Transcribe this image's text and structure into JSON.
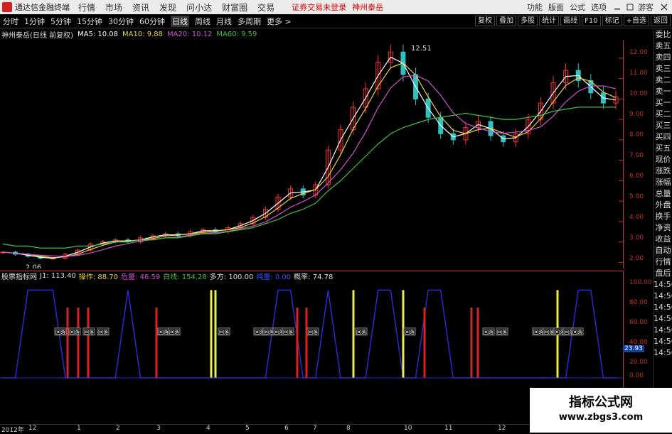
{
  "titlebar": {
    "app_name": "通达信金融终端",
    "menus": [
      "行情",
      "市场",
      "资讯",
      "发现",
      "问小达",
      "财富圈",
      "交易"
    ],
    "notice": "证券交易未登录",
    "stock_name": "神州泰岳",
    "right_items": [
      "功能",
      "版面",
      "公式",
      "选项",
      "游客"
    ]
  },
  "periods": [
    "分时",
    "1分钟",
    "5分钟",
    "15分钟",
    "30分钟",
    "60分钟",
    "日线",
    "周线",
    "月线",
    "多周期",
    "更多 >"
  ],
  "active_period": "日线",
  "tools": [
    "复权",
    "叠加",
    "多股",
    "统计",
    "画线",
    "F10",
    "标记",
    "+自选",
    "返回"
  ],
  "info": {
    "label": "神州泰岳(日线 前复权)",
    "ma5": "MA5: 10.08",
    "ma10": "MA10: 9.88",
    "ma20": "MA20: 10.12",
    "ma60": "MA60: 9.59"
  },
  "high_label": "12.51",
  "low_label": "2.06",
  "price_axis": [
    "12.00",
    "11.00",
    "10.00",
    "9.00",
    "8.00",
    "7.00",
    "6.00",
    "5.00",
    "4.00",
    "3.00",
    "2.00"
  ],
  "sub": {
    "name": "股票指标网",
    "j1": "J1: 113.40",
    "op": "操作: 88.70",
    "danger": "危量: 46.59",
    "white": "白线: 154.28",
    "multi": "多方: 100.00",
    "buy": "纯量: 0.00",
    "prob": "概率: 74.78"
  },
  "sub_axis": [
    "100.00",
    "80.00",
    "60.00",
    "40.00",
    "20.00",
    "0.00"
  ],
  "sub_value": "23.93",
  "time_axis": [
    "2012年",
    "12",
    "1",
    "2",
    "3",
    "4",
    "5",
    "6",
    "7",
    "8",
    "10",
    "11",
    "12"
  ],
  "sidebar": [
    "委比",
    "卖五",
    "卖四",
    "卖三",
    "卖二",
    "卖一",
    "买一",
    "买二",
    "买三",
    "买四",
    "买五",
    "现价",
    "涨跌",
    "涨幅",
    "总量",
    "外盘",
    "换手",
    "净资",
    "收益",
    "自动",
    "行情",
    "盘后",
    "14:56",
    "14:56",
    "14:56",
    "14:56",
    "14:56",
    "14:56",
    "14:56"
  ],
  "signal_label": "回落",
  "watermark": {
    "line1": "指标公式网",
    "line2": "www.zbgs3.com"
  },
  "colors": {
    "ma5": "#ffffff",
    "ma10": "#e6d640",
    "ma20": "#d050d0",
    "ma60": "#40c040",
    "up": "#ff3030",
    "down": "#30c0c0"
  },
  "chart_data": {
    "type": "candlestick",
    "ylim": [
      1.7,
      12.9
    ],
    "price_series_approx": [
      2.5,
      2.4,
      2.3,
      2.2,
      2.2,
      2.4,
      2.6,
      2.9,
      3.0,
      3.1,
      3.0,
      3.2,
      3.3,
      3.4,
      3.3,
      3.5,
      3.6,
      3.5,
      3.7,
      3.9,
      4.2,
      4.6,
      5.2,
      5.6,
      5.3,
      5.8,
      7.5,
      8.5,
      9.6,
      10.5,
      11.8,
      12.3,
      11.2,
      10.0,
      9.1,
      8.3,
      8.0,
      8.6,
      8.9,
      8.2,
      7.9,
      8.3,
      9.0,
      9.8,
      10.8,
      11.4,
      10.9,
      10.3,
      9.8,
      10.1
    ],
    "ma60_approx": [
      2.9,
      2.8,
      2.8,
      2.7,
      2.7,
      2.7,
      2.8,
      2.8,
      2.9,
      3.0,
      3.0,
      3.1,
      3.1,
      3.2,
      3.2,
      3.3,
      3.4,
      3.4,
      3.5,
      3.6,
      3.7,
      3.9,
      4.1,
      4.4,
      4.6,
      4.9,
      5.5,
      6.0,
      6.6,
      7.2,
      7.8,
      8.3,
      8.6,
      8.8,
      9.0,
      9.1,
      9.2,
      9.3,
      9.2,
      9.1,
      9.0,
      9.0,
      9.1,
      9.2,
      9.4,
      9.5,
      9.6,
      9.6,
      9.6,
      9.6
    ],
    "sub_ylim": [
      0,
      110
    ],
    "blue_wave_approx": [
      0,
      0,
      100,
      100,
      100,
      0,
      0,
      0,
      0,
      0,
      100,
      0,
      0,
      0,
      0,
      0,
      0,
      0,
      0,
      0,
      0,
      0,
      100,
      100,
      0,
      0,
      100,
      0,
      0,
      0,
      100,
      100,
      0,
      0,
      100,
      100,
      0,
      0,
      0,
      0,
      0,
      0,
      0,
      0,
      0,
      0,
      100,
      100,
      0,
      0
    ],
    "red_bars_x": [
      95,
      110,
      124,
      220,
      297,
      418,
      431,
      567,
      597,
      663,
      672
    ],
    "yellow_bars_x": [
      297,
      303,
      497,
      567,
      784
    ],
    "signal_x": [
      85,
      105,
      125,
      145,
      230,
      245,
      315,
      365,
      378,
      392,
      405,
      440,
      508,
      576,
      687,
      706,
      757,
      772,
      787,
      800,
      812
    ]
  }
}
